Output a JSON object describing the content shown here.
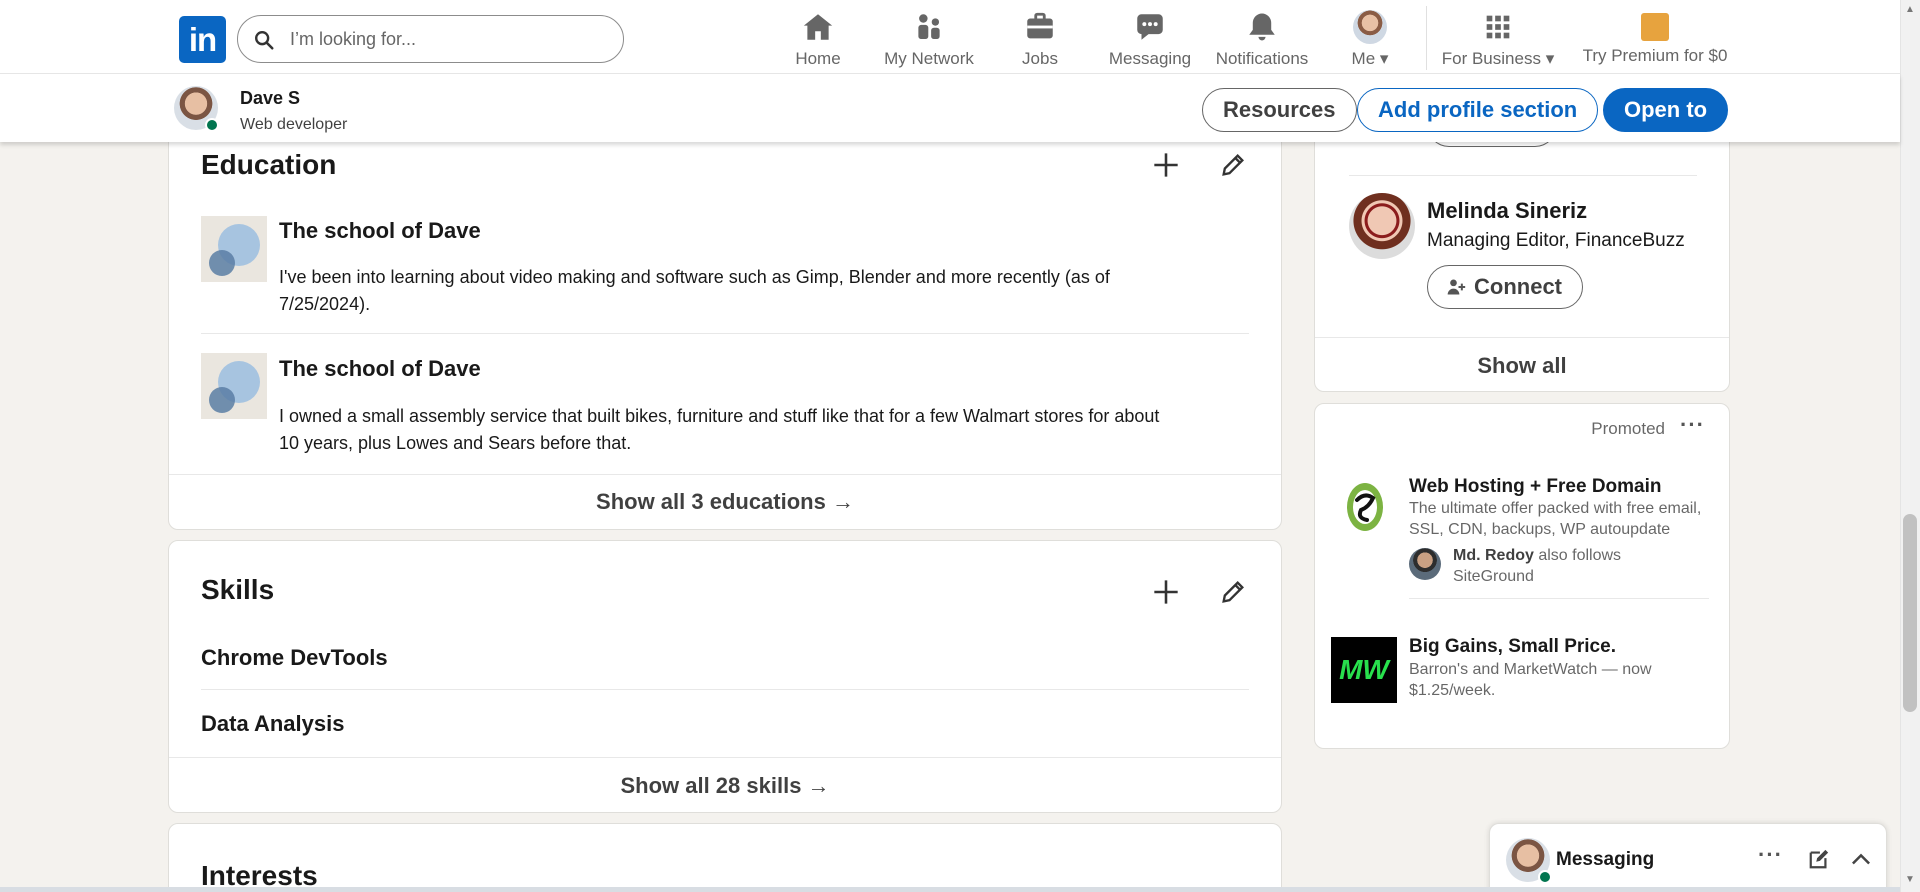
{
  "nav": {
    "logo_text": "in",
    "search_placeholder": "I’m looking for...",
    "items": [
      {
        "label": "Home",
        "icon": "home-icon"
      },
      {
        "label": "My Network",
        "icon": "my-network-icon"
      },
      {
        "label": "Jobs",
        "icon": "jobs-icon"
      },
      {
        "label": "Messaging",
        "icon": "messaging-icon"
      },
      {
        "label": "Notifications",
        "icon": "notifications-icon"
      },
      {
        "label": "Me",
        "icon": "me-avatar"
      },
      {
        "label": "For Business",
        "icon": "grid-icon"
      },
      {
        "label": "Try Premium for $0",
        "icon": "premium-icon"
      }
    ]
  },
  "profile_header": {
    "name": "Dave S",
    "headline": "Web developer",
    "buttons": {
      "resources": "Resources",
      "add_section": "Add profile section",
      "open_to": "Open to"
    }
  },
  "education": {
    "title": "Education",
    "entries": [
      {
        "school": "The school of Dave",
        "description_line1": "I've been into learning about video making and software such as Gimp, Blender and more recently (as of",
        "description_line2": "7/25/2024)."
      },
      {
        "school": "The school of Dave",
        "description_line1": "I owned a small assembly service that built bikes, furniture and stuff like that for a few Walmart stores for about",
        "description_line2": "10 years, plus Lowes and Sears before that."
      }
    ],
    "show_all": "Show all 3 educations →"
  },
  "skills": {
    "title": "Skills",
    "items": [
      "Chrome DevTools",
      "Data Analysis"
    ],
    "show_all": "Show all 28 skills →"
  },
  "interests": {
    "title": "Interests"
  },
  "people_card": {
    "person": {
      "name": "Melinda Sineriz",
      "headline": "Managing Editor, FinanceBuzz",
      "connect_label": "Connect"
    },
    "show_all": "Show all"
  },
  "promoted": {
    "label": "Promoted",
    "ads": [
      {
        "title": "Web Hosting + Free Domain",
        "body": "The ultimate offer packed with free email, SSL, CDN, backups, WP autoupdate",
        "follower_name": "Md. Redoy",
        "follower_text": "also follows SiteGround",
        "logo_text": ""
      },
      {
        "title": "Big Gains, Small Price.",
        "body": "Barron's and MarketWatch — now $1.25/week.",
        "logo_text": "MW"
      }
    ]
  },
  "messaging": {
    "label": "Messaging"
  },
  "colors": {
    "brand": "#0a66c2",
    "online": "#01754f",
    "background": "#f4f2ee",
    "siteground_green": "#7cb342",
    "mw_green": "#28e04d"
  }
}
